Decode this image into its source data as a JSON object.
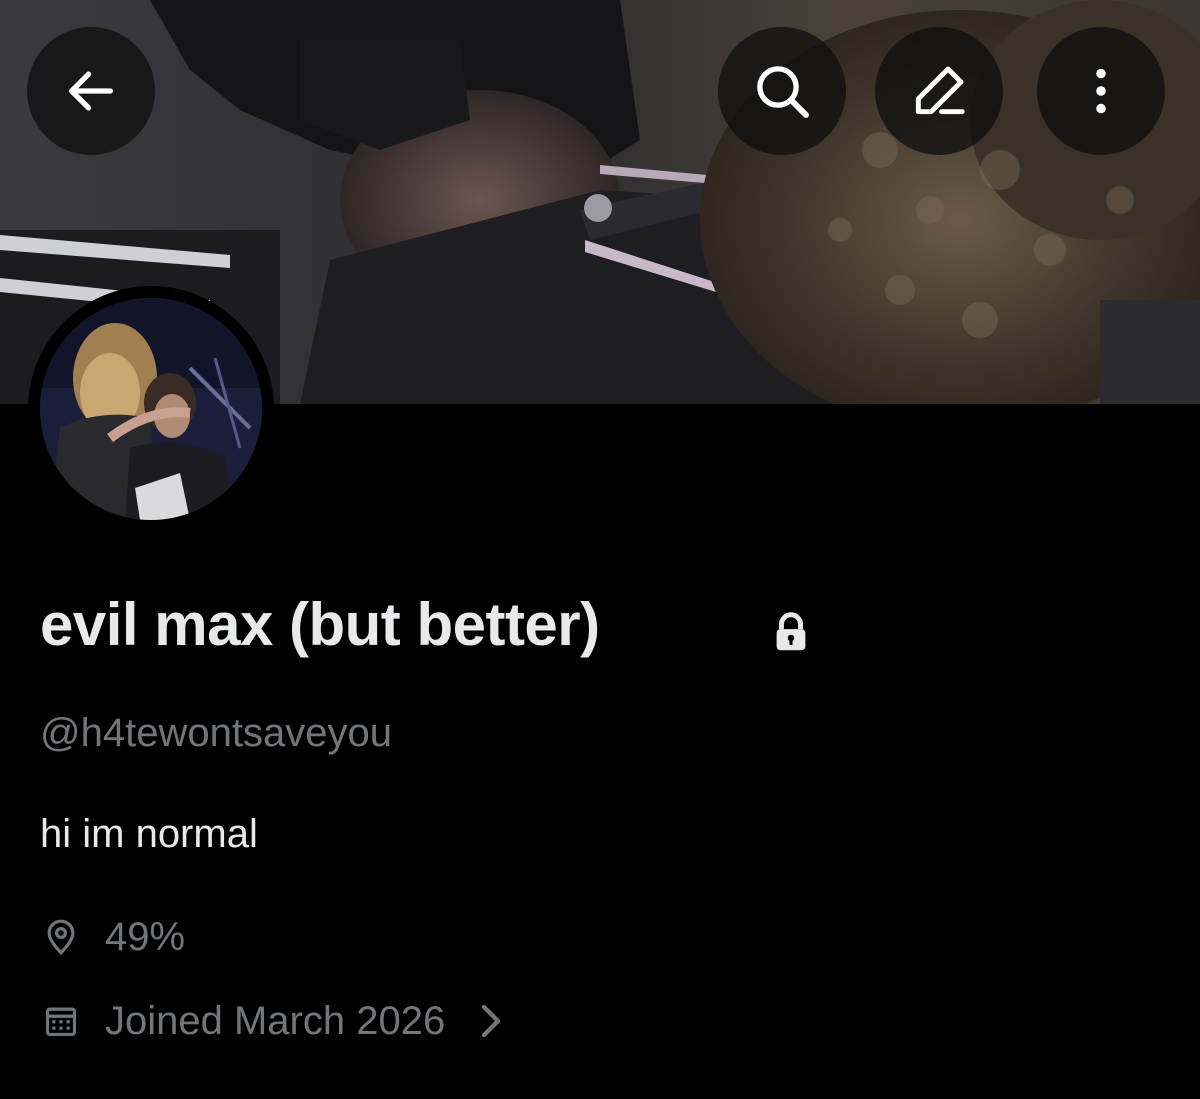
{
  "header": {
    "back_icon": "arrow-left-icon",
    "search_icon": "search-icon",
    "edit_icon": "pencil-icon",
    "more_icon": "more-vertical-icon"
  },
  "profile": {
    "display_name": "evil max (but better)",
    "protected_icon": "lock-icon",
    "handle": "@h4tewontsaveyou",
    "bio": "hi im normal",
    "location": "49%",
    "location_icon": "location-pin-icon",
    "joined": "Joined March 2026",
    "joined_icon": "calendar-icon",
    "joined_chevron_icon": "chevron-right-icon"
  },
  "colors": {
    "background": "#000000",
    "primary_text": "#e7e9ea",
    "secondary_text": "#71767b",
    "button_bg": "#0f0f0f"
  }
}
